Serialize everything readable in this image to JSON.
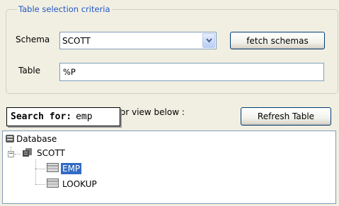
{
  "group": {
    "title": "Table selection criteria"
  },
  "schema": {
    "label": "Schema",
    "value": "SCOTT",
    "fetch_button": "fetch schemas"
  },
  "table": {
    "label": "Table",
    "value": "%P"
  },
  "list_caption": "or view below :",
  "refresh_button": "Refresh Table",
  "tooltip": {
    "prefix": "Search for:",
    "query": "emp"
  },
  "tree": {
    "root": "Database",
    "schema": "SCOTT",
    "tables": [
      "EMP",
      "LOOKUP"
    ],
    "selected": "EMP"
  },
  "colors": {
    "accent": "#316ac5",
    "legend": "#2258c8",
    "border": "#7f9db9"
  }
}
